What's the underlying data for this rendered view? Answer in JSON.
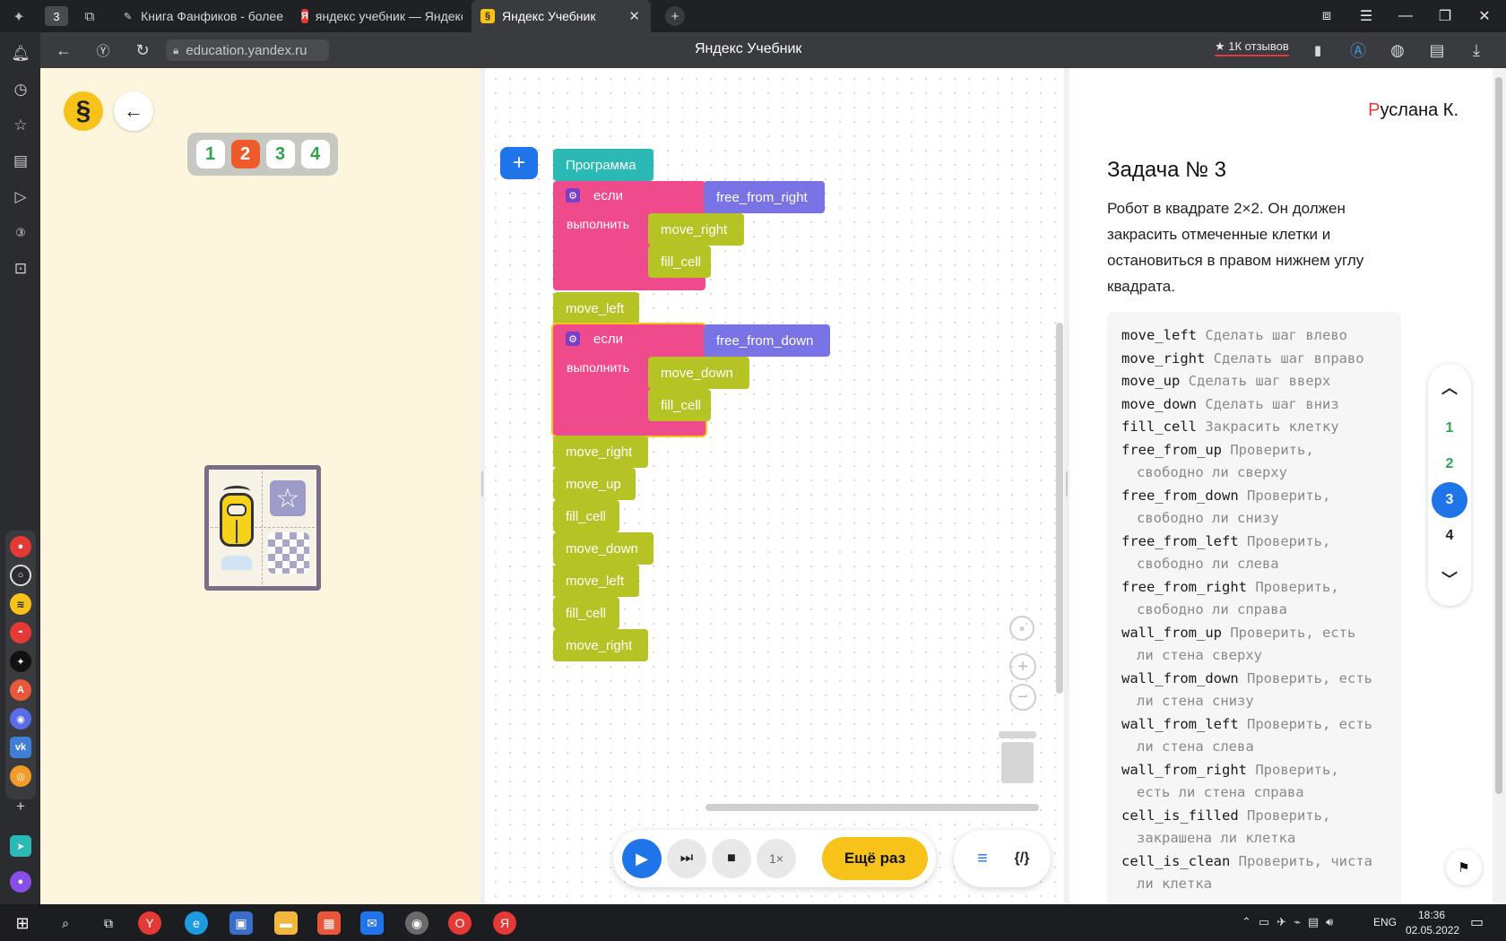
{
  "browser": {
    "tab_counter": "3",
    "tabs": [
      {
        "title": "Книга Фанфиков - более"
      },
      {
        "title": "яндекс учебник — Яндекс"
      },
      {
        "title": "Яндекс Учебник"
      }
    ],
    "url": "education.yandex.ru",
    "page_title": "Яндекс Учебник",
    "reviews_label": "★ 1К отзывов"
  },
  "game": {
    "logo_symbol": "§",
    "back_arrow": "←",
    "levels": [
      "1",
      "2",
      "3",
      "4"
    ],
    "current_level": "2",
    "level_colors": {
      "done": "#2fa34a",
      "current": "#ef5a2a"
    }
  },
  "workspace": {
    "add_button": "+",
    "program_label": "Программа",
    "blocks": {
      "if1_label": "если",
      "if1_do": "выполнить",
      "if1_cond": "free_from_right",
      "if1_body": [
        "move_right",
        "fill_cell"
      ],
      "after_if1": "move_left",
      "if2_label": "если",
      "if2_do": "выполнить",
      "if2_cond": "free_from_down",
      "if2_body": [
        "move_down",
        "fill_cell"
      ],
      "tail": [
        "move_right",
        "move_up",
        "fill_cell",
        "move_down",
        "move_left",
        "fill_cell",
        "move_right"
      ]
    },
    "block_colors": {
      "command": "#b5c424",
      "if": "#ef4a8b",
      "condition": "#7a73e6",
      "program": "#2bb9b5"
    }
  },
  "controls": {
    "speed": "1×",
    "again_button": "Ещё раз"
  },
  "task": {
    "user": "Руслана К.",
    "title": "Задача № 3",
    "description": "Робот в квадрате 2×2. Он должен закрасить отмеченные клетки и остановиться в правом нижнем углу квадрата.",
    "commands": [
      {
        "name": "move_left",
        "desc": "Сделать шаг влево"
      },
      {
        "name": "move_right",
        "desc": "Сделать шаг вправо"
      },
      {
        "name": "move_up",
        "desc": "Сделать шаг вверх"
      },
      {
        "name": "move_down",
        "desc": "Сделать шаг вниз"
      },
      {
        "name": "fill_cell",
        "desc": "Закрасить клетку"
      },
      {
        "name": "free_from_up",
        "desc": "Проверить,",
        "desc2": "свободно ли сверху"
      },
      {
        "name": "free_from_down",
        "desc": "Проверить,",
        "desc2": "свободно ли снизу"
      },
      {
        "name": "free_from_left",
        "desc": "Проверить,",
        "desc2": "свободно ли слева"
      },
      {
        "name": "free_from_right",
        "desc": "Проверить,",
        "desc2": "свободно ли справа"
      },
      {
        "name": "wall_from_up",
        "desc": "Проверить, есть",
        "desc2": "ли стена сверху"
      },
      {
        "name": "wall_from_down",
        "desc": "Проверить, есть",
        "desc2": "ли стена снизу"
      },
      {
        "name": "wall_from_left",
        "desc": "Проверить, есть",
        "desc2": "ли стена слева"
      },
      {
        "name": "wall_from_right",
        "desc": "Проверить,",
        "desc2": "есть ли стена справа"
      },
      {
        "name": "cell_is_filled",
        "desc": "Проверить,",
        "desc2": "закрашена ли клетка"
      },
      {
        "name": "cell_is_clean",
        "desc": "Проверить, чиста",
        "desc2": "ли клетка"
      }
    ],
    "nav": [
      "1",
      "2",
      "3",
      "4"
    ],
    "nav_current": "3"
  },
  "taskbar": {
    "lang": "ENG",
    "time": "18:36",
    "date": "02.05.2022"
  }
}
